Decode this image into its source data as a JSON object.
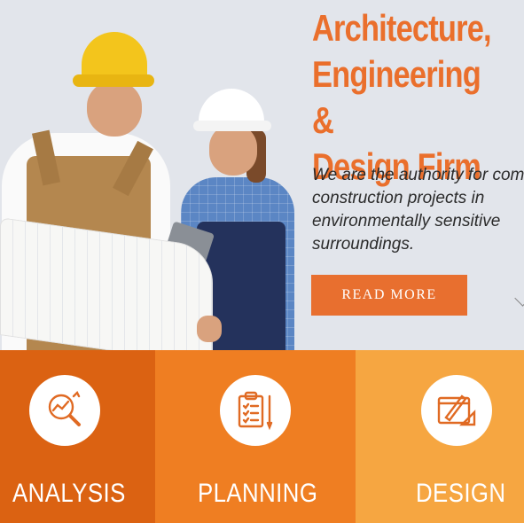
{
  "hero": {
    "title": "Architecture,\nEngineering &\nDesign Firm",
    "description_lines": [
      "We are the authority for com",
      "construction projects in",
      "environmentally sensitive",
      "surroundings."
    ],
    "read_more_label": "READ MORE"
  },
  "services": [
    {
      "label": "ANALYSIS",
      "icon": "analysis-magnifier-chart-icon",
      "color": "#db6212"
    },
    {
      "label": "PLANNING",
      "icon": "clipboard-checklist-icon",
      "color": "#ef7e22"
    },
    {
      "label": "DESIGN",
      "icon": "blueprint-pencil-ruler-icon",
      "color": "#f6a641"
    }
  ],
  "colors": {
    "accent": "#ea6f2c",
    "button": "#e86f2f",
    "icon_stroke": "#e06a23"
  }
}
